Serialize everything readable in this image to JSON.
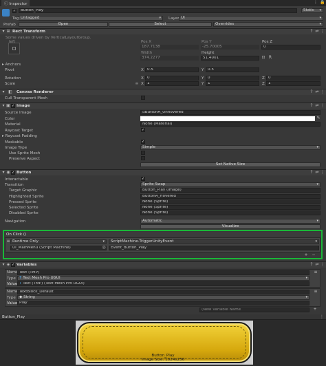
{
  "window": {
    "tab": "Inspector"
  },
  "object": {
    "name": "Button_Play",
    "static": "Static",
    "tag_label": "Tag",
    "tag": "Untagged",
    "layer_label": "Layer",
    "layer": "UI",
    "prefab_label": "Prefab",
    "open": "Open",
    "select": "Select",
    "overrides": "Overrides"
  },
  "rect": {
    "title": "Rect Transform",
    "note": "Some values driven by VerticalLayoutGroup.",
    "pivot_mode": "left",
    "pos_x_label": "Pos X",
    "pos_x": "187.7138",
    "pos_y_label": "Pos Y",
    "pos_y": "-25.70005",
    "pos_z_label": "Pos Z",
    "pos_z": "0",
    "width_label": "Width",
    "width": "374.2277",
    "height_label": "Height",
    "height": "51.4001",
    "anchors": "Anchors",
    "pivot": "Pivot",
    "pivot_x": "0.5",
    "pivot_y": "0.5",
    "rotation": "Rotation",
    "rot_x": "0",
    "rot_y": "0",
    "rot_z": "0",
    "scale": "Scale",
    "scale_x": "1",
    "scale_y": "1",
    "scale_z": "1",
    "x": "X",
    "y": "Y",
    "z": "Z"
  },
  "canvas_renderer": {
    "title": "Canvas Renderer",
    "cull_label": "Cull Transparent Mesh"
  },
  "image": {
    "title": "Image",
    "source_label": "Source Image",
    "source": "ButtonA_Unhovered",
    "color_label": "Color",
    "material_label": "Material",
    "material": "None (Material)",
    "raycast_label": "Raycast Target",
    "padding_label": "Raycast Padding",
    "maskable_label": "Maskable",
    "type_label": "Image Type",
    "type": "Simple",
    "sprite_mesh_label": "Use Sprite Mesh",
    "preserve_label": "Preserve Aspect",
    "native_button": "Set Native Size"
  },
  "button": {
    "title": "Button",
    "interactable_label": "Interactable",
    "transition_label": "Transition",
    "transition": "Sprite Swap",
    "target_label": "Target Graphic",
    "target": "Button_Play (Image)",
    "highlighted_label": "Highlighted Sprite",
    "highlighted": "ButtonA_Hovered",
    "pressed_label": "Pressed Sprite",
    "pressed": "None (Sprite)",
    "selected_label": "Selected Sprite",
    "selected": "None (Sprite)",
    "disabled_label": "Disabled Sprite",
    "disabled": "None (Sprite)",
    "navigation_label": "Navigation",
    "navigation": "Automatic",
    "visualize": "Visualize"
  },
  "onclick": {
    "title": "On Click ()",
    "runtime": "Runtime Only",
    "function": "ScriptMachine.TriggerUnityEvent",
    "object": "UI_MainMenu (Script Machine)",
    "argument": "Event_Button_Play",
    "add": "+",
    "remove": "−"
  },
  "variables": {
    "title": "Variables",
    "rows": [
      {
        "name_label": "Name",
        "name": "Text (TMP)",
        "type_label": "Type",
        "type": "Text Mesh Pro UGUI",
        "value_label": "Value",
        "value": "Text (TMP) (Text Mesh Pro UGUI)"
      },
      {
        "name_label": "Name",
        "name": "TextBlock_Default",
        "type_label": "Type",
        "type": "String",
        "value_label": "Value",
        "value": "Play"
      }
    ],
    "new_variable": "(New Variable Name"
  },
  "preview": {
    "title": "Button_Play",
    "caption": "Button_Play",
    "size": "Image Size: 1024x256"
  },
  "colors": {
    "accent": "#1ab738",
    "gold": "#e8c21a"
  }
}
